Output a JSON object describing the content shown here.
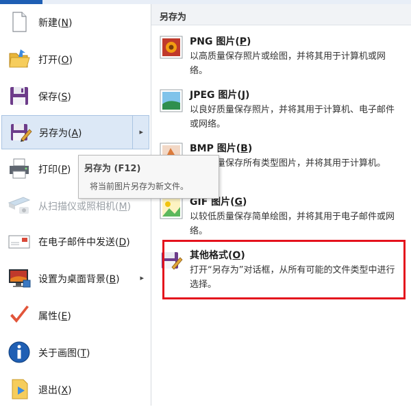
{
  "menu": {
    "items": [
      {
        "name": "new",
        "label": "新建",
        "key": "N",
        "icon": "new-file-icon"
      },
      {
        "name": "open",
        "label": "打开",
        "key": "O",
        "icon": "open-folder-icon"
      },
      {
        "name": "save",
        "label": "保存",
        "key": "S",
        "icon": "floppy-disk-icon"
      },
      {
        "name": "save-as",
        "label": "另存为",
        "key": "A",
        "icon": "save-as-icon",
        "active": true,
        "submenu_arrow": "▸"
      },
      {
        "name": "print",
        "label": "打印",
        "key": "P",
        "icon": "printer-icon",
        "submenu_arrow": "▸"
      },
      {
        "name": "from-scanner",
        "label": "从扫描仪或照相机",
        "key": "M",
        "icon": "scanner-camera-icon",
        "disabled": true
      },
      {
        "name": "send-email",
        "label": "在电子邮件中发送",
        "key": "D",
        "icon": "email-icon"
      },
      {
        "name": "set-desktop",
        "label": "设置为桌面背景",
        "key": "B",
        "icon": "desktop-background-icon",
        "submenu_arrow": "▸"
      },
      {
        "name": "properties",
        "label": "属性",
        "key": "E",
        "icon": "checkmark-icon"
      },
      {
        "name": "about",
        "label": "关于画图",
        "key": "T",
        "icon": "info-icon"
      },
      {
        "name": "exit",
        "label": "退出",
        "key": "X",
        "icon": "exit-icon"
      }
    ]
  },
  "tooltip": {
    "title": "另存为 (F12)",
    "description": "将当前图片另存为新文件。"
  },
  "save_as_panel": {
    "title": "另存为",
    "options": [
      {
        "name": "png",
        "title": "PNG 图片",
        "key": "P",
        "description": "以高质量保存照片或绘图，并将其用于计算机或网络。",
        "icon": "png-image-icon"
      },
      {
        "name": "jpeg",
        "title": "JPEG 图片",
        "key": "J",
        "description": "以良好质量保存照片，并将其用于计算机、电子邮件或网络。",
        "icon": "jpeg-image-icon"
      },
      {
        "name": "bmp",
        "title": "BMP 图片",
        "key": "B",
        "description": "以高质量保存所有类型图片，并将其用于计算机。",
        "icon": "bmp-image-icon"
      },
      {
        "name": "gif",
        "title": "GIF 图片",
        "key": "G",
        "description": "以较低质量保存简单绘图，并将其用于电子邮件或网络。",
        "icon": "gif-image-icon"
      },
      {
        "name": "other",
        "title": "其他格式",
        "key": "O",
        "description": "打开“另存为”对话框，从所有可能的文件类型中进行选择。",
        "icon": "other-formats-icon",
        "highlighted": true
      }
    ]
  },
  "colors": {
    "highlight_border": "#e4121c",
    "active_item_bg": "#dce8f6",
    "accent": "#1f5fb4"
  }
}
